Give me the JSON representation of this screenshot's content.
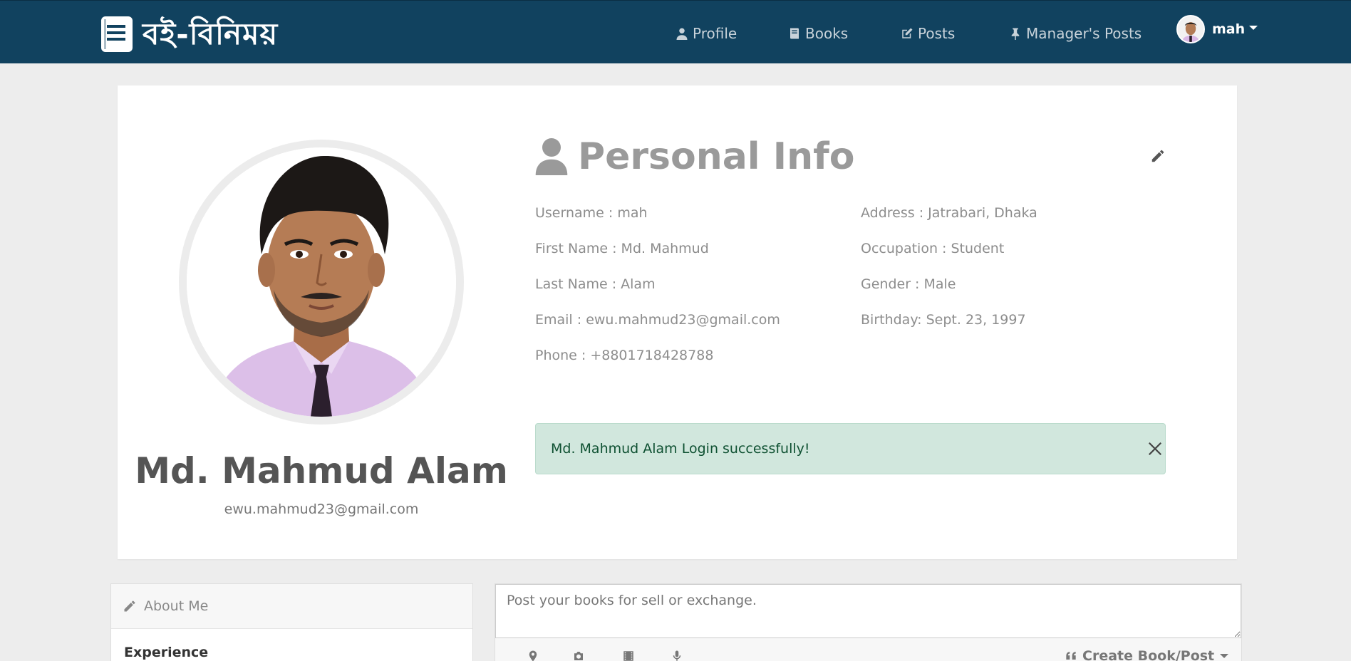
{
  "nav": {
    "brand": "বই-বিনিময়",
    "items": [
      {
        "label": "Profile",
        "icon": "user-icon"
      },
      {
        "label": "Books",
        "icon": "book-icon"
      },
      {
        "label": "Posts",
        "icon": "edit-icon"
      },
      {
        "label": "Manager's Posts",
        "icon": "pin-icon"
      }
    ],
    "user": {
      "name": "mah"
    }
  },
  "profile": {
    "full_name": "Md. Mahmud Alam",
    "email": "ewu.mahmud23@gmail.com",
    "personal_info_title": "Personal Info",
    "left_fields": [
      "Username : mah",
      "First Name : Md. Mahmud",
      "Last Name : Alam",
      "Email : ewu.mahmud23@gmail.com",
      "Phone : +8801718428788"
    ],
    "right_fields": [
      "Address : Jatrabari, Dhaka",
      "Occupation : Student",
      "Gender : Male",
      "Birthday: Sept. 23, 1997"
    ]
  },
  "alert": {
    "message": "Md. Mahmud Alam Login successfully!"
  },
  "about": {
    "title": "About Me",
    "experience_label": "Experience"
  },
  "post": {
    "placeholder": "Post your books for sell or exchange.",
    "create_label": "Create Book/Post"
  },
  "colors": {
    "navbar": "#11425f",
    "alert_bg": "#d1e7dd",
    "alert_text": "#0f5132"
  }
}
